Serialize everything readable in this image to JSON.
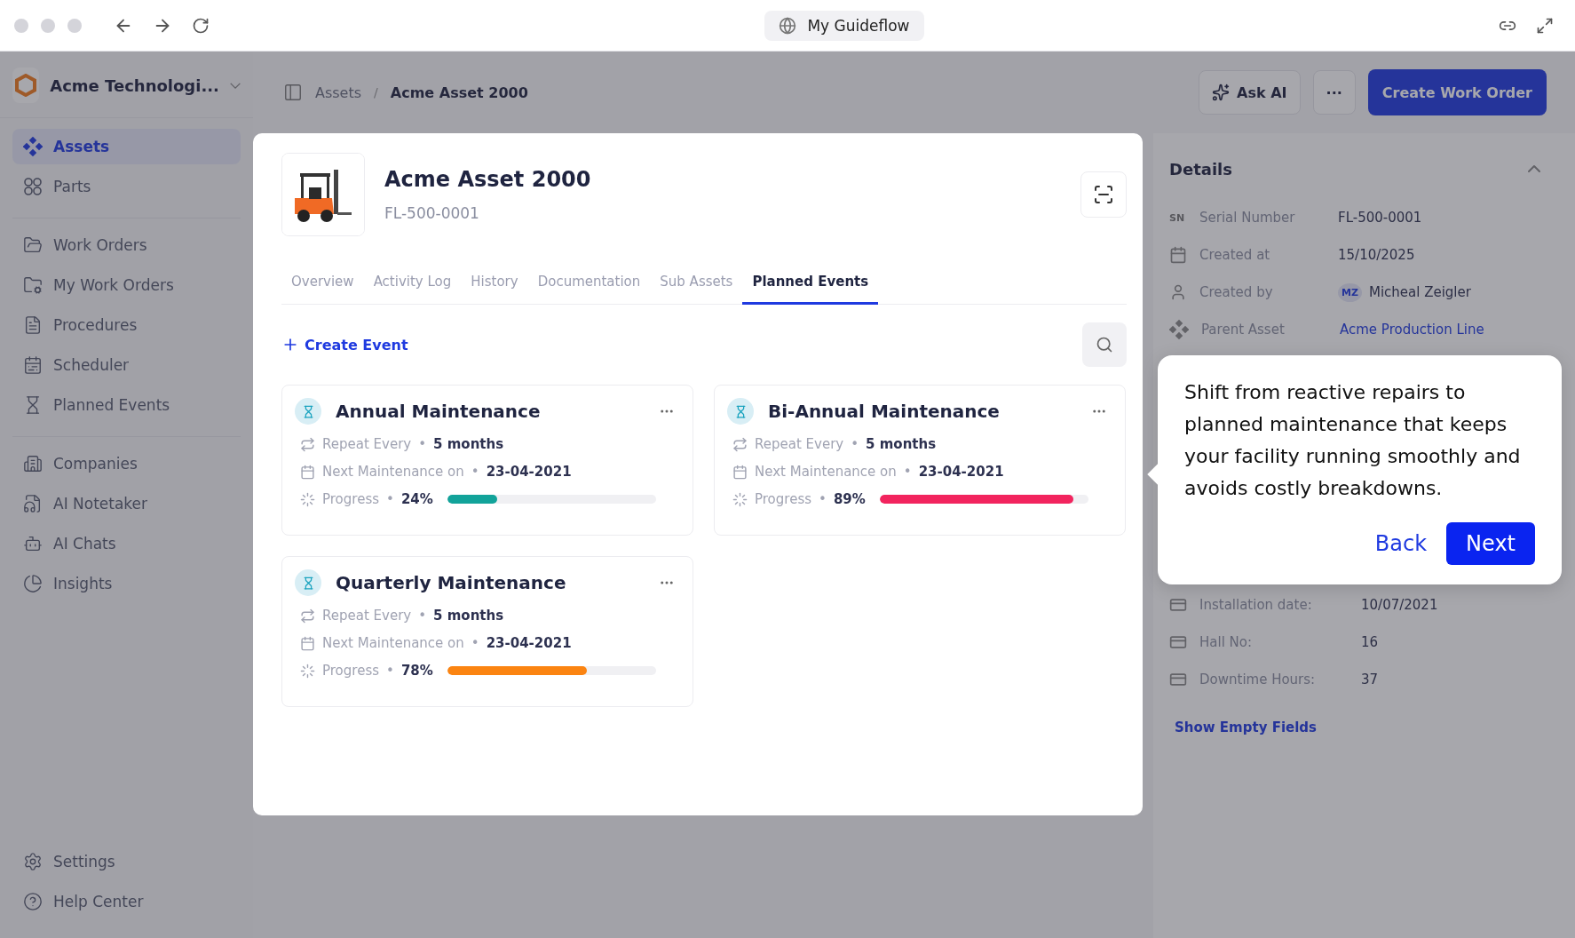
{
  "browser": {
    "title": "My Guideflow"
  },
  "sidebar": {
    "org": "Acme Technologi...",
    "items": [
      {
        "label": "Assets",
        "selected": true
      },
      {
        "label": "Parts",
        "selected": false
      },
      {
        "label": "Work Orders",
        "selected": false
      },
      {
        "label": "My Work Orders",
        "selected": false
      },
      {
        "label": "Procedures",
        "selected": false
      },
      {
        "label": "Scheduler",
        "selected": false
      },
      {
        "label": "Planned Events",
        "selected": false
      },
      {
        "label": "Companies",
        "selected": false
      },
      {
        "label": "AI Notetaker",
        "selected": false
      },
      {
        "label": "AI Chats",
        "selected": false
      },
      {
        "label": "Insights",
        "selected": false
      }
    ],
    "footer": [
      "Settings",
      "Help Center"
    ]
  },
  "header": {
    "breadcrumb": [
      "Assets",
      "Acme Asset 2000"
    ],
    "breadcrumb_separator": "/",
    "ask_ai": "Ask AI",
    "more": "···",
    "create": "Create Work Order"
  },
  "asset": {
    "name": "Acme Asset 2000",
    "code": "FL-500-0001",
    "tabs": [
      {
        "label": "Overview",
        "selected": false
      },
      {
        "label": "Activity Log",
        "selected": false
      },
      {
        "label": "History",
        "selected": false
      },
      {
        "label": "Documentation",
        "selected": false
      },
      {
        "label": "Sub Assets",
        "selected": false
      },
      {
        "label": "Planned Events",
        "selected": true
      }
    ],
    "create_event": "Create Event",
    "separator": "•",
    "events": [
      {
        "title": "Annual Maintenance",
        "repeat_label": "Repeat Every",
        "repeat": "5 months",
        "next_label": "Next Maintenance on",
        "next": "23-04-2021",
        "progress_label": "Progress",
        "progress": "24%",
        "level": 0.24,
        "color": "#12a39a"
      },
      {
        "title": "Bi-Annual Maintenance",
        "repeat_label": "Repeat Every",
        "repeat": "5 months",
        "next_label": "Next Maintenance on",
        "next": "23-04-2021",
        "progress_label": "Progress",
        "progress": "89%",
        "level": 0.93,
        "color": "#f2245e"
      },
      {
        "title": "Quarterly Maintenance",
        "repeat_label": "Repeat Every",
        "repeat": "5 months",
        "next_label": "Next Maintenance on",
        "next": "23-04-2021",
        "progress_label": "Progress",
        "progress": "78%",
        "level": 0.67,
        "color": "#fb8411"
      }
    ]
  },
  "details": {
    "title": "Details",
    "rows": [
      {
        "kind": "sn",
        "badge": "SN",
        "label": "Serial Number",
        "value": "FL-500-0001"
      },
      {
        "kind": "date",
        "label": "Created at",
        "value": "15/10/2025"
      },
      {
        "kind": "user",
        "label": "Created by",
        "initials": "MZ",
        "value": "Micheal Zeigler"
      },
      {
        "kind": "link",
        "label": "Parent Asset",
        "value": "Acme Production Line"
      }
    ],
    "custom_rows": [
      {
        "label": "Installation date:",
        "value": "10/07/2021"
      },
      {
        "label": "Hall No:",
        "value": "16"
      },
      {
        "label": "Downtime Hours:",
        "value": "37"
      }
    ],
    "show_empty": "Show Empty Fields"
  },
  "tour": {
    "text": "Shift from reactive repairs to planned maintenance that keeps your facility running smoothly and avoids costly breakdowns.",
    "back": "Back",
    "next": "Next"
  }
}
